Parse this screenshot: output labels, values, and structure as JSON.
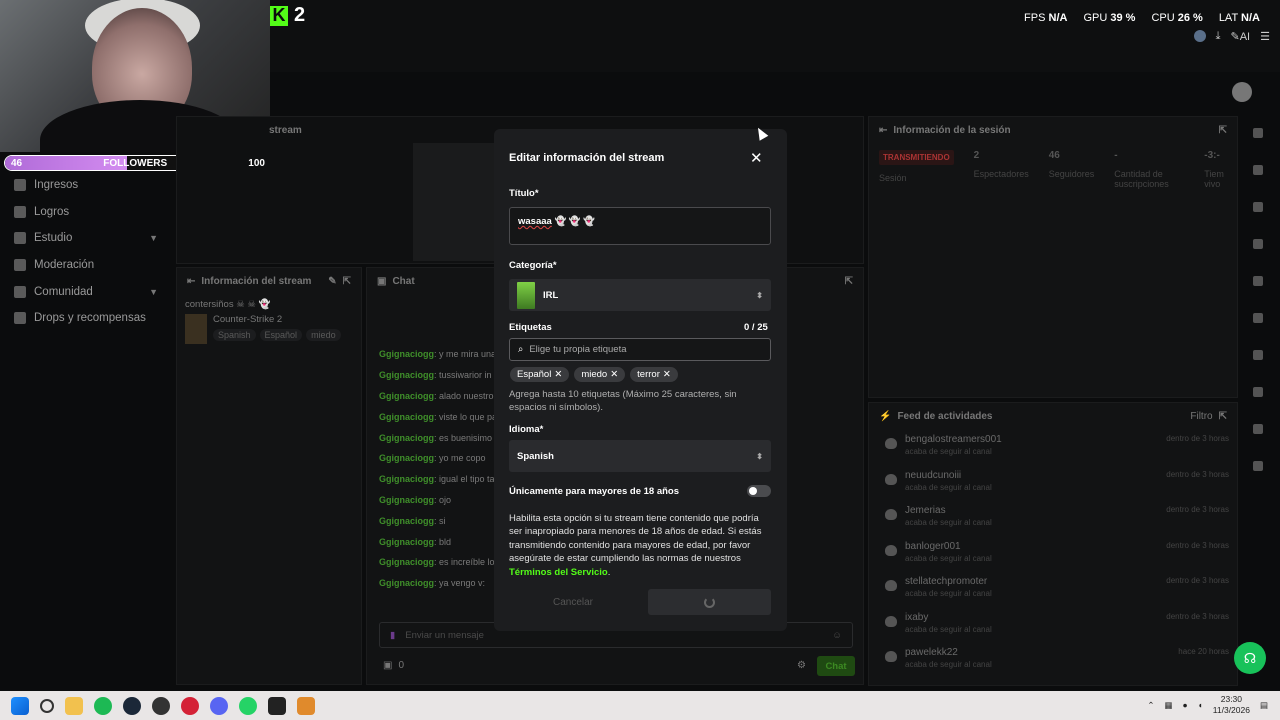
{
  "header": {
    "logo_num": "2",
    "stats": [
      {
        "label": "FPS",
        "value": "N/A"
      },
      {
        "label": "GPU",
        "value": "39 %"
      },
      {
        "label": "CPU",
        "value": "26 %"
      },
      {
        "label": "LAT",
        "value": "N/A"
      }
    ],
    "ai_label": "AI"
  },
  "followers": {
    "current": "46",
    "label": "FOLLOWERS",
    "goal": "100",
    "progress": 0.46
  },
  "sidebar": {
    "items": [
      {
        "label": "Ingresos",
        "icon": "bank-icon",
        "chevron": false
      },
      {
        "label": "Logros",
        "icon": "trophy-icon",
        "chevron": false
      },
      {
        "label": "Estudio",
        "icon": "grid-icon",
        "chevron": true
      },
      {
        "label": "Moderación",
        "icon": "wrench-icon",
        "chevron": false
      },
      {
        "label": "Comunidad",
        "icon": "people-icon",
        "chevron": true
      },
      {
        "label": "Drops y recompensas",
        "icon": "gift-icon",
        "chevron": false
      }
    ]
  },
  "stream_preview": {
    "label": "stream"
  },
  "stream_info": {
    "title": "Información del stream",
    "stream_title": "contersiños ☠ ☠ 👻",
    "game": "Counter-Strike 2",
    "tags": [
      "Spanish",
      "Español",
      "miedo"
    ]
  },
  "chat": {
    "title": "Chat",
    "lines": [
      {
        "user": "Ggignaciogg",
        "msg": "y me mira una"
      },
      {
        "user": "Ggignaciogg",
        "msg": "tussiwarior in"
      },
      {
        "user": "Ggignaciogg",
        "msg": "alado nuestro"
      },
      {
        "user": "Ggignaciogg",
        "msg": "viste lo que pa"
      },
      {
        "user": "Ggignaciogg",
        "msg": "es buenisimo"
      },
      {
        "user": "Ggignaciogg",
        "msg": "yo me copo"
      },
      {
        "user": "Ggignaciogg",
        "msg": "igual el tipo ta"
      },
      {
        "user": "Ggignaciogg",
        "msg": "ojo"
      },
      {
        "user": "Ggignaciogg",
        "msg": "si"
      },
      {
        "user": "Ggignaciogg",
        "msg": "bld"
      },
      {
        "user": "Ggignaciogg",
        "msg": "es increíble lo"
      },
      {
        "user": "Ggignaciogg",
        "msg": "ya vengo v:"
      }
    ],
    "input_placeholder": "Enviar un mensaje",
    "viewer_count": "0",
    "send_label": "Chat"
  },
  "session": {
    "title": "Información de la sesión",
    "status": "TRANSMITIENDO",
    "status_label": "Sesión",
    "stats": [
      {
        "value": "2",
        "label": "Espectadores"
      },
      {
        "value": "46",
        "label": "Seguidores"
      },
      {
        "value": "-",
        "label": "Cantidad de suscripciones"
      },
      {
        "value": "-3:-",
        "label": "Tiem vivo"
      }
    ]
  },
  "activity": {
    "title": "Feed de actividades",
    "filter": "Filtro",
    "items": [
      {
        "user": "bengalostreamers001",
        "sub": "acaba de seguir al canal",
        "time": "dentro de 3 horas"
      },
      {
        "user": "neuudcunoiii",
        "sub": "acaba de seguir al canal",
        "time": "dentro de 3 horas"
      },
      {
        "user": "Jemerias",
        "sub": "acaba de seguir al canal",
        "time": "dentro de 3 horas"
      },
      {
        "user": "banloger001",
        "sub": "acaba de seguir al canal",
        "time": "dentro de 3 horas"
      },
      {
        "user": "stellatechpromoter",
        "sub": "acaba de seguir al canal",
        "time": "dentro de 3 horas"
      },
      {
        "user": "ixaby",
        "sub": "acaba de seguir al canal",
        "time": "dentro de 3 horas"
      },
      {
        "user": "pawelekk22",
        "sub": "acaba de seguir al canal",
        "time": "hace 20 horas"
      }
    ]
  },
  "modal": {
    "title": "Editar información del stream",
    "title_label": "Título*",
    "title_value": "wasaaa",
    "title_emojis": "👻 👻 👻",
    "category_label": "Categoría*",
    "category_value": "IRL",
    "tags_label": "Etiquetas",
    "tags_count": "0 / 25",
    "tags_placeholder": "Elige tu propia etiqueta",
    "tags": [
      "Español",
      "miedo",
      "terror"
    ],
    "tags_help": "Agrega hasta 10 etiquetas (Máximo 25 caracteres, sin espacios ni símbolos).",
    "language_label": "Idioma*",
    "language_value": "Spanish",
    "mature_label": "Únicamente para mayores de 18 años",
    "mature_enabled": false,
    "mature_desc": "Habilita esta opción si tu stream tiene contenido que podría ser inapropiado para menores de 18 años de edad. Si estás transmitiendo contenido para mayores de edad, por favor asegúrate de estar cumpliendo las normas de nuestros",
    "terms_link": "Términos del Servicio",
    "terms_end": ".",
    "cancel_label": "Cancelar"
  },
  "taskbar": {
    "apps": [
      "windows-start",
      "search",
      "file-explorer",
      "spotify",
      "steam",
      "obs",
      "opera",
      "discord",
      "whatsapp",
      "kick",
      "other"
    ],
    "time": "23:30",
    "date": "11/3/2026",
    "colors": {
      "spotify": "#1db954",
      "discord": "#5865f2",
      "whatsapp": "#25d366",
      "steam": "#1b2838",
      "kick": "#53fc18"
    }
  }
}
